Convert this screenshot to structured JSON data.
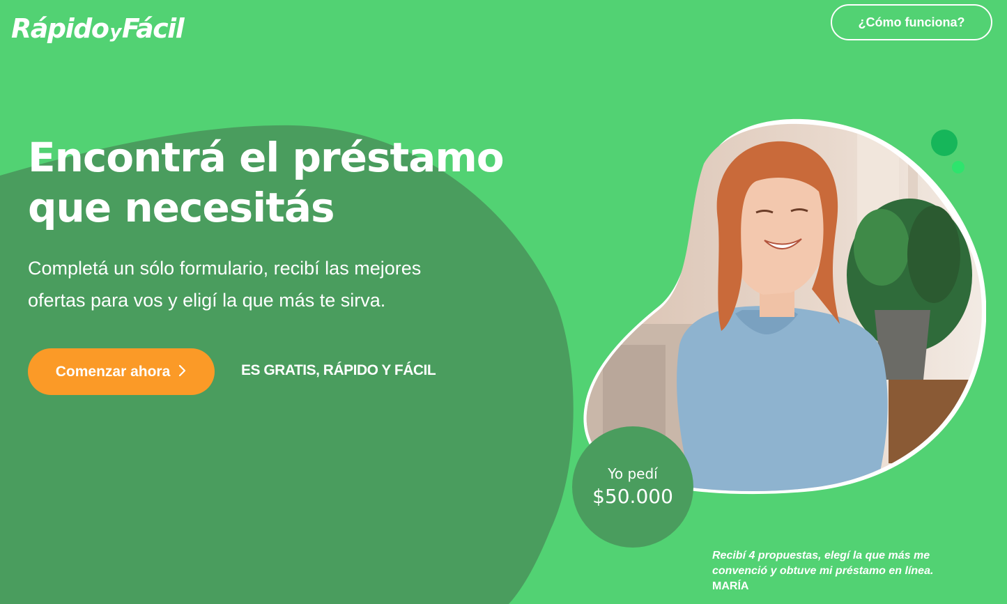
{
  "header": {
    "logo": {
      "part1": "Rápido",
      "part2": "y",
      "part3": "Fácil"
    },
    "how_it_works_label": "¿Cómo funciona?"
  },
  "hero": {
    "title_line1": "Encontrá el préstamo",
    "title_line2": "que necesitás",
    "subtitle_line1": "Completá un sólo formulario, recibí las mejores",
    "subtitle_line2": "ofertas para vos y eligí la que más te sirva.",
    "cta_label": "Comenzar ahora",
    "cta_icon": "chevron-right-icon",
    "tagline": "ES GRATIS, RÁPIDO Y FÁCIL"
  },
  "testimonial": {
    "badge_line1": "Yo pedí",
    "badge_amount": "$50.000",
    "quote_line1": "Recibí 4 propuestas, elegí la que más me",
    "quote_line2": "convenció y obtuve mi préstamo en línea.",
    "name": "MARÍA"
  },
  "colors": {
    "background": "#52d273",
    "dark_green": "#4a9d5e",
    "cta": "#fb9a27",
    "text": "#ffffff"
  }
}
